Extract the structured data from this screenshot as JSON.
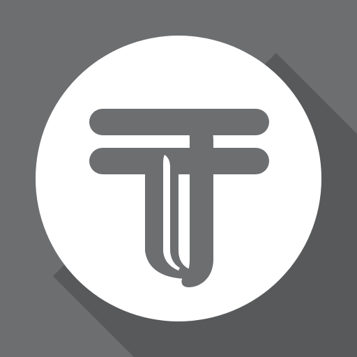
{
  "icon": {
    "name": "tenge-currency-icon",
    "colors": {
      "background": "#6d6e70",
      "long_shadow": "#58595b",
      "circle": "#ffffff",
      "glyph": "#6d6e70"
    }
  }
}
